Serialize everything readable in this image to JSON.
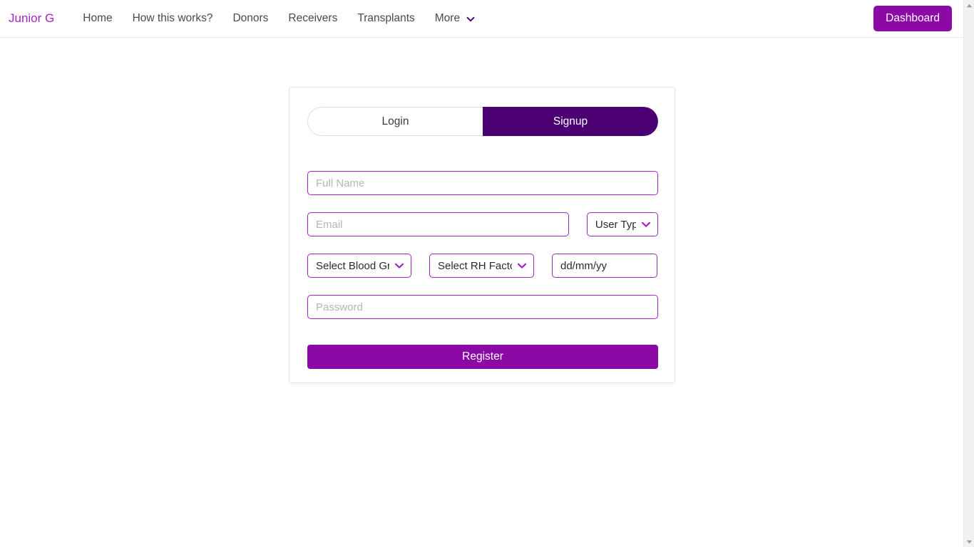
{
  "navbar": {
    "brand": "Junior G",
    "links": [
      {
        "label": "Home",
        "icon": null
      },
      {
        "label": "How this works?",
        "icon": null
      },
      {
        "label": "Donors",
        "icon": null
      },
      {
        "label": "Receivers",
        "icon": null
      },
      {
        "label": "Transplants",
        "icon": null
      },
      {
        "label": "More",
        "icon": "chevron-down-icon"
      }
    ],
    "dashboard_button": "Dashboard"
  },
  "auth_card": {
    "tabs": {
      "login": "Login",
      "signup": "Signup",
      "active": "Signup"
    },
    "form": {
      "full_name": {
        "placeholder": "Full Name",
        "value": ""
      },
      "email": {
        "placeholder": "Email",
        "value": ""
      },
      "user_type": {
        "selected": "User Type",
        "icon": "chevron-down-icon"
      },
      "blood_group": {
        "selected": "Select Blood Group",
        "icon": "chevron-down-icon"
      },
      "rh_factor": {
        "selected": "Select RH Factor",
        "icon": "chevron-down-icon"
      },
      "date_of_birth": {
        "value": "dd/mm/yy"
      },
      "password": {
        "placeholder": "Password",
        "value": ""
      },
      "submit": "Register"
    }
  },
  "scrollbar": {
    "up_icon": "scroll-up-arrow-icon",
    "down_icon": "scroll-down-arrow-icon"
  },
  "colors": {
    "brand": "#a226c4",
    "accent": "#8b0aa5",
    "tab_active": "#4b0072",
    "field_border": "#a226c4",
    "placeholder": "#b6b6b6"
  }
}
